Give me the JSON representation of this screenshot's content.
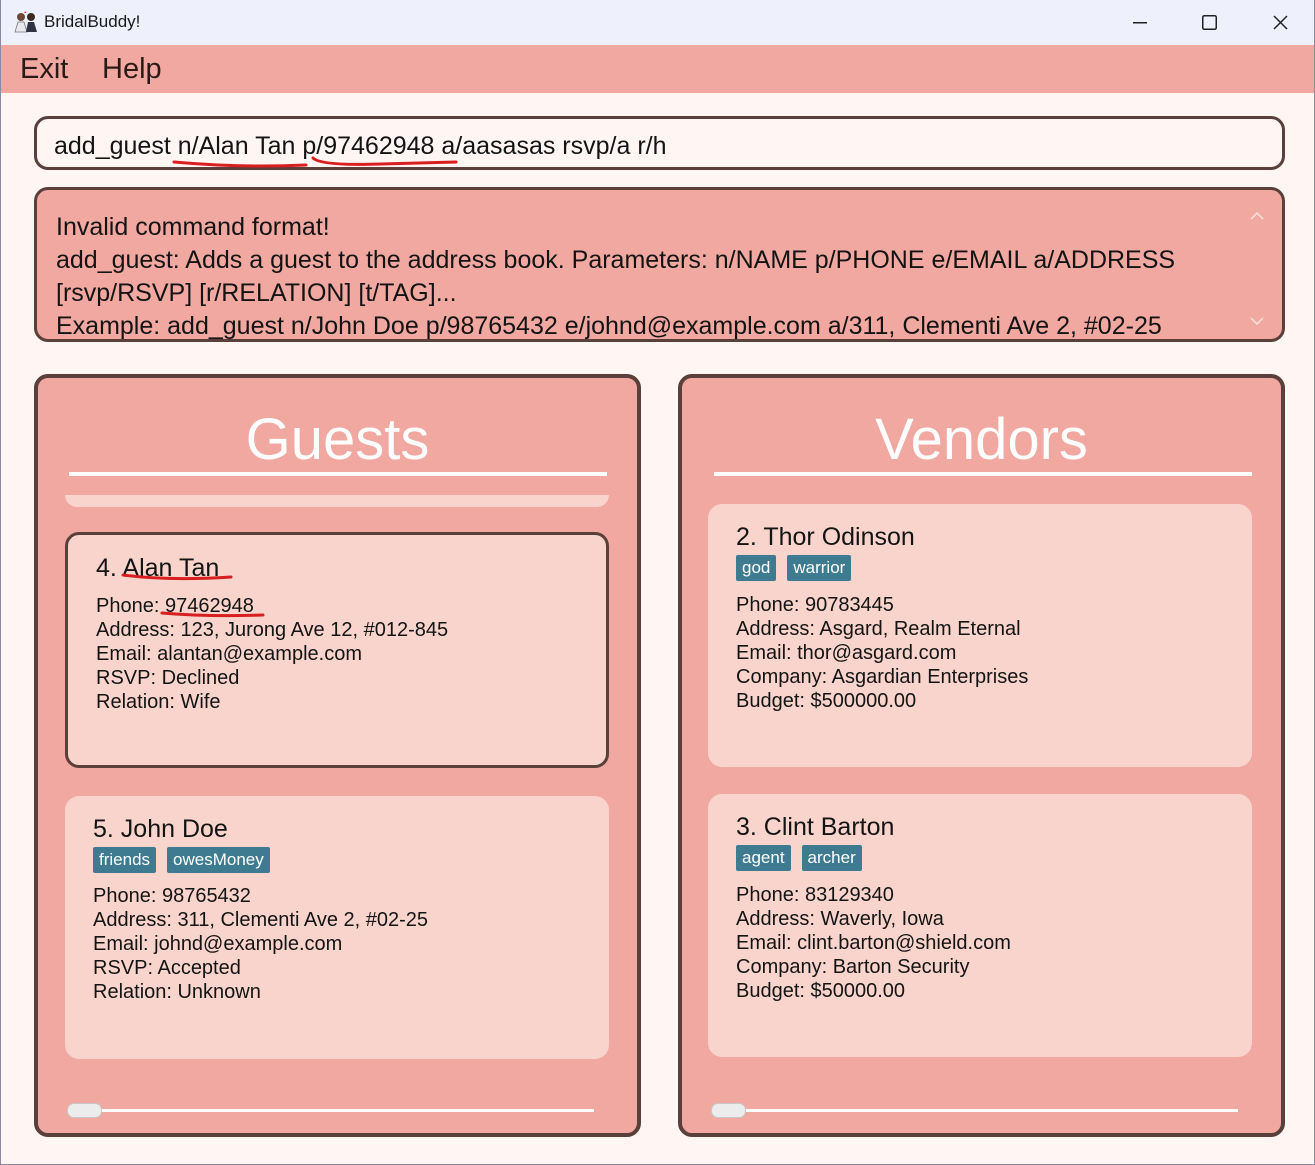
{
  "window": {
    "title": "BridalBuddy!",
    "controls": [
      "minimize-icon",
      "maximize-icon",
      "close-icon"
    ]
  },
  "menu": {
    "exit": "Exit",
    "help": "Help"
  },
  "command_box": {
    "value": "add_guest n/Alan Tan p/97462948 a/aasasas rsvp/a r/h"
  },
  "result_display": {
    "text": "Invalid command format!\nadd_guest: Adds a guest to the address book. Parameters: n/NAME p/PHONE e/EMAIL a/ADDRESS [rsvp/RSVP] [r/RELATION] [t/TAG]...\nExample: add_guest n/John Doe p/98765432 e/johnd@example.com a/311, Clementi Ave 2, #02-25"
  },
  "guests": {
    "title": "Guests",
    "cards": [
      {
        "name": "4. Alan Tan",
        "tags": [],
        "phone": "Phone: 97462948",
        "address": "Address: 123, Jurong Ave 12, #012-845",
        "email": "Email: alantan@example.com",
        "rsvp": "RSVP: Declined",
        "relation": "Relation: Wife"
      },
      {
        "name": "5. John Doe",
        "tags": [
          "friends",
          "owesMoney"
        ],
        "phone": "Phone: 98765432",
        "address": "Address: 311, Clementi Ave 2, #02-25",
        "email": "Email: johnd@example.com",
        "rsvp": "RSVP: Accepted",
        "relation": "Relation: Unknown"
      }
    ]
  },
  "vendors": {
    "title": "Vendors",
    "cards": [
      {
        "name": "2. Thor Odinson",
        "tags": [
          "god",
          "warrior"
        ],
        "phone": "Phone: 90783445",
        "address": "Address: Asgard, Realm Eternal",
        "email": "Email: thor@asgard.com",
        "company": "Company: Asgardian Enterprises",
        "budget": "Budget: $500000.00"
      },
      {
        "name": "3. Clint Barton",
        "tags": [
          "agent",
          "archer"
        ],
        "phone": "Phone: 83129340",
        "address": "Address: Waverly, Iowa",
        "email": "Email: clint.barton@shield.com",
        "company": "Company: Barton Security",
        "budget": "Budget: $50000.00"
      }
    ]
  },
  "colors": {
    "accent": "#f0a8a0",
    "card": "#f8d4cc",
    "border": "#5b3f3a",
    "tag": "#3e7b91",
    "annotation": "#d81e1e"
  }
}
